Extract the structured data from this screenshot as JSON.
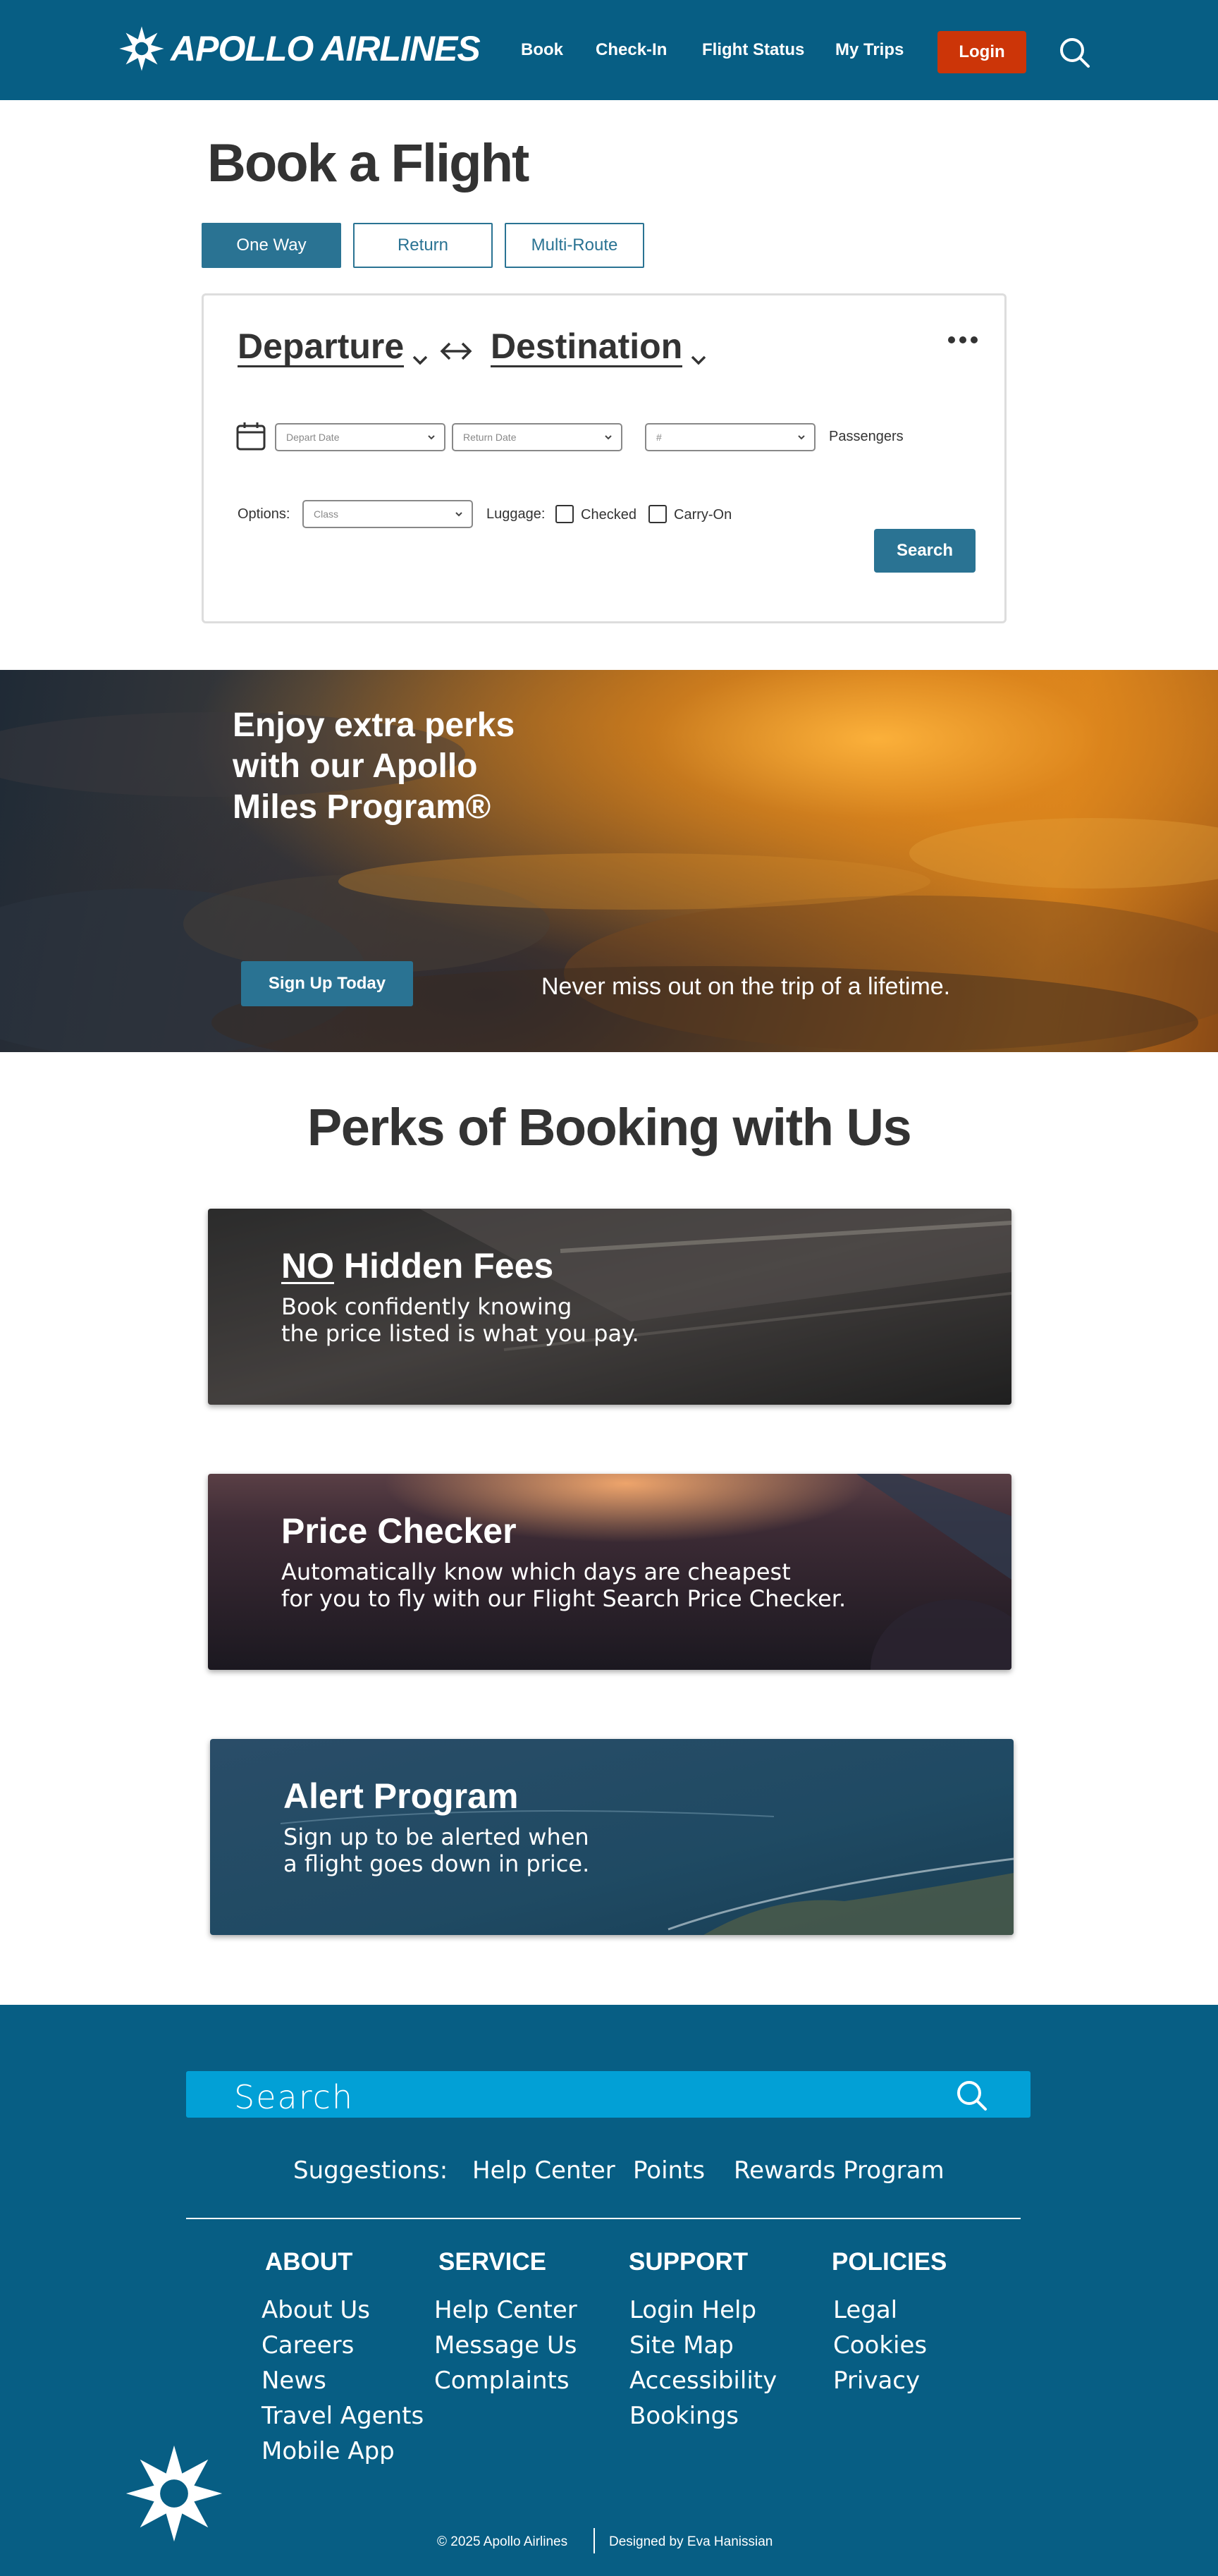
{
  "header": {
    "brand": "APOLLO AIRLINES",
    "nav": [
      "Book",
      "Check-In",
      "Flight Status",
      "My Trips"
    ],
    "login_label": "Login"
  },
  "booking": {
    "title": "Book a Flight",
    "trip_types": [
      "One Way",
      "Return",
      "Multi-Route"
    ],
    "active_trip_type": "One Way",
    "departure_label": "Departure",
    "destination_label": "Destination",
    "depart_date_placeholder": "Depart Date",
    "return_date_placeholder": "Return Date",
    "passengers_placeholder": "#",
    "passengers_label": "Passengers",
    "options_label": "Options:",
    "class_placeholder": "Class",
    "luggage_label": "Luggage:",
    "checked_label": "Checked",
    "carryon_label": "Carry-On",
    "search_label": "Search"
  },
  "promo": {
    "title": "Enjoy extra perks with our Apollo Miles Program®",
    "signup_label": "Sign Up Today",
    "tagline": "Never miss out on the trip of a lifetime."
  },
  "perks": {
    "title": "Perks of Booking with Us",
    "items": [
      {
        "title_emphasis": "NO",
        "title": "Hidden Fees",
        "desc_line1": "Book confidently knowing",
        "desc_line2": "the price listed is what you pay."
      },
      {
        "title": "Price Checker",
        "desc_line1": "Automatically know which days are cheapest",
        "desc_line2": "for you to fly with our Flight Search Price Checker."
      },
      {
        "title": "Alert Program",
        "desc_line1": "Sign up to be alerted when",
        "desc_line2": "a flight goes down in price."
      }
    ]
  },
  "footer": {
    "search_placeholder": "Search",
    "suggestions_label": "Suggestions:",
    "suggestions": [
      "Help Center",
      "Points",
      "Rewards Program"
    ],
    "columns": [
      {
        "title": "ABOUT",
        "links": [
          "About Us",
          "Careers",
          "News",
          "Travel Agents",
          "Mobile App"
        ]
      },
      {
        "title": "SERVICE",
        "links": [
          "Help Center",
          "Message Us",
          "Complaints"
        ]
      },
      {
        "title": "SUPPORT",
        "links": [
          "Login Help",
          "Site Map",
          "Accessibility",
          "Bookings"
        ]
      },
      {
        "title": "POLICIES",
        "links": [
          "Legal",
          "Cookies",
          "Privacy"
        ]
      }
    ],
    "copyright": "© 2025 Apollo Airlines",
    "credit": "Designed by Eva Hanissian"
  },
  "colors": {
    "brand_blue": "#075e84",
    "button_blue": "#2a7393",
    "login_red": "#cc3508",
    "footer_search": "#02a0d6"
  }
}
